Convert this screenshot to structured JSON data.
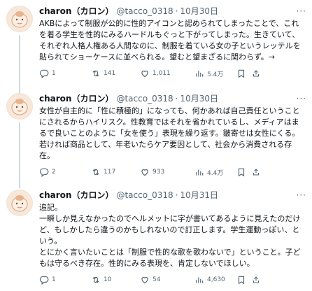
{
  "tweets": [
    {
      "name": "charon（カロン）",
      "handle": "@tacco_0318",
      "date": "10月30日",
      "text": "AKBによって制服が公的に性的アイコンと認められてしまったことで、これを着る学生を性的にみるハードルもぐっと下がってしまった。生きていて、それぞれ人格人権ある人間なのに、制服を着ている女の子というレッテルを貼られてショーケースに並べられる。望むと望まざるに関わらず。→",
      "replies": "1",
      "retweets": "141",
      "likes": "1,011",
      "views": "5.4万"
    },
    {
      "name": "charon（カロン）",
      "handle": "@tacco_0318",
      "date": "10月30日",
      "text": "女性が自主的に「性に積極的」になっても、何かあれば自己責任ということにされるからハイリスク。性教育ではそれを省かれているし、メディアはまるで良いことのように「女を使う」表現を繰り返す。皺寄せは女性にくる。若ければ商品として、年老いたらケア要因として、社会から消費される存在。",
      "replies": "2",
      "retweets": "117",
      "likes": "933",
      "views": "4.4万"
    },
    {
      "name": "charon（カロン）",
      "handle": "@tacco_0318",
      "date": "10月31日",
      "text": "追記。\n一瞬しか見えなかったのでヘルメットに字が書いてあるように見えたのだけど、もしかしたら違うのかもしれないので訂正します。学生運動っぽい、という。\nとにかく言いたいことは「制服で性的な歌を歌わないで」ということ。子どもは守るべき存在。性的にみる表現を、肯定しないでほしい。",
      "replies": "1",
      "retweets": "10",
      "likes": "54",
      "views": "4,630"
    }
  ],
  "icons": {
    "reply": "reply-icon",
    "retweet": "retweet-icon",
    "like": "heart-icon",
    "views": "views-chart-icon",
    "bookmark": "bookmark-icon",
    "share": "share-icon",
    "more": "more-icon"
  },
  "colors": {
    "text": "#0f1419",
    "muted": "#536471",
    "thread_line": "#cfd9de",
    "avatar_bg": "#f7e8da"
  }
}
